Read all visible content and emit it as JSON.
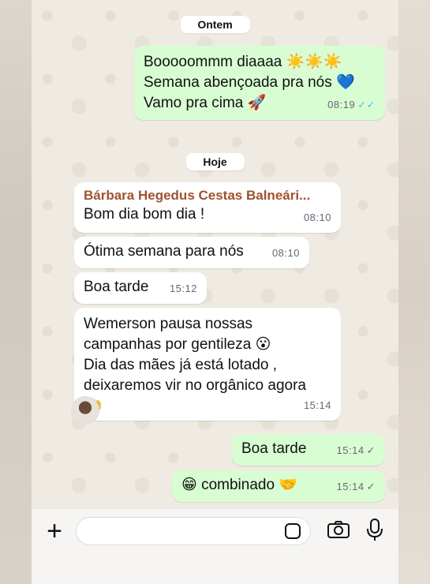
{
  "dates": {
    "yesterday": "Ontem",
    "today": "Hoje"
  },
  "messages": [
    {
      "text": "Booooommm diaaaa ☀️☀️☀️\nSemana abençoada pra nós 💙\nVamo pra cima 🚀",
      "time": "08:19",
      "ticks": "✓✓"
    },
    {
      "sender": "Bárbara Hegedus Cestas Balneári...",
      "text": "Bom dia bom dia !",
      "time": "08:10"
    },
    {
      "text": "Ótima semana para nós",
      "time": "08:10"
    },
    {
      "text": "Boa tarde",
      "time": "15:12"
    },
    {
      "text": "Wemerson pausa nossas\ncampanhas por gentileza 😮\nDia das mães já está lotado ,\ndeixaremos vir no orgânico agora\n🙌",
      "time": "15:14"
    },
    {
      "text": "Boa tarde",
      "time": "15:14",
      "ticks": "✓"
    },
    {
      "text": "😁 combinado 🤝",
      "time": "15:14",
      "ticks": "✓"
    }
  ],
  "input": {
    "placeholder": ""
  },
  "icons": [
    "plus-icon",
    "sticker-icon",
    "camera-icon",
    "microphone-icon"
  ],
  "colors": {
    "incoming": "#ffffff",
    "outgoing": "#d9fdd3",
    "sender": "#a0522d",
    "read_ticks": "#53bdeb"
  }
}
